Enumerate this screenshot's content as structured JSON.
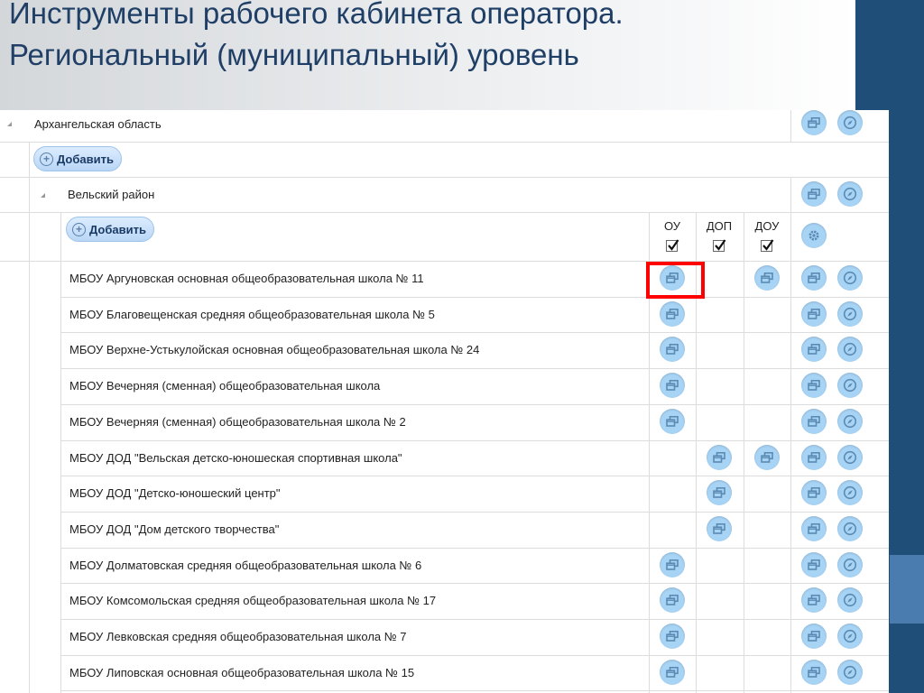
{
  "title": {
    "line1": "Инструменты рабочего кабинета оператора.",
    "line2": "Региональный (муниципальный) уровень"
  },
  "region": {
    "name": "Архангельская область"
  },
  "add_label": "Добавить",
  "district": {
    "name": "Вельский район"
  },
  "columns": [
    "ОУ",
    "ДОП",
    "ДОУ"
  ],
  "columns_checked": [
    true,
    true,
    true
  ],
  "schools": [
    {
      "name": "МБОУ Аргуновская основная общеобразовательная школа № 11",
      "ou": true,
      "dop": false,
      "dou": true,
      "highlighted": true
    },
    {
      "name": "МБОУ Благовещенская средняя общеобразовательная школа № 5",
      "ou": true,
      "dop": false,
      "dou": false
    },
    {
      "name": "МБОУ Верхне-Устькулойская основная общеобразовательная школа № 24",
      "ou": true,
      "dop": false,
      "dou": false
    },
    {
      "name": "МБОУ Вечерняя (сменная) общеобразовательная школа",
      "ou": true,
      "dop": false,
      "dou": false
    },
    {
      "name": "МБОУ Вечерняя (сменная) общеобразовательная школа № 2",
      "ou": true,
      "dop": false,
      "dou": false
    },
    {
      "name": "МБОУ ДОД \"Вельская детско-юношеская спортивная школа\"",
      "ou": false,
      "dop": true,
      "dou": true
    },
    {
      "name": "МБОУ ДОД \"Детско-юношеский центр\"",
      "ou": false,
      "dop": true,
      "dou": false
    },
    {
      "name": "МБОУ ДОД \"Дом детского творчества\"",
      "ou": false,
      "dop": true,
      "dou": false
    },
    {
      "name": "МБОУ Долматовская средняя общеобразовательная школа № 6",
      "ou": true,
      "dop": false,
      "dou": false
    },
    {
      "name": "МБОУ Комсомольская средняя общеобразовательная школа № 17",
      "ou": true,
      "dop": false,
      "dou": false
    },
    {
      "name": "МБОУ Левковская средняя общеобразовательная школа № 7",
      "ou": true,
      "dop": false,
      "dou": false
    },
    {
      "name": "МБОУ Липовская основная общеобразовательная школа № 15",
      "ou": true,
      "dop": false,
      "dou": false
    }
  ],
  "icons": {
    "windows": "windows-icon",
    "compass": "compass-icon",
    "gear": "gear-icon"
  },
  "colors": {
    "title": "#1f3f66",
    "band": "#1f4e79",
    "icon_bg": "#a7d3f5",
    "highlight": "#ff0000"
  }
}
